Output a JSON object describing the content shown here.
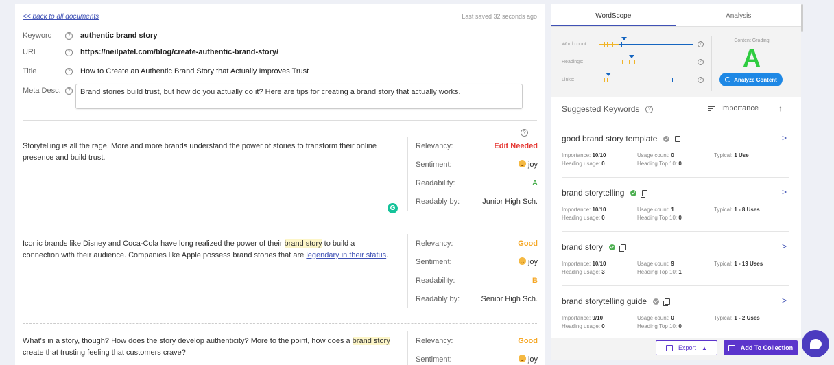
{
  "nav": {
    "back_label": "<< back to all documents",
    "last_saved": "Last saved 32 seconds ago"
  },
  "meta": {
    "keyword": {
      "label": "Keyword",
      "value": "authentic brand story"
    },
    "url": {
      "label": "URL",
      "value": "https://neilpatel.com/blog/create-authentic-brand-story/"
    },
    "title": {
      "label": "Title",
      "value": "How to Create an Authentic Brand Story that Actually Improves Trust"
    },
    "meta_desc": {
      "label": "Meta Desc.",
      "value": "Brand stories build trust, but how do you actually do it? Here are tips for creating a brand story that actually works."
    }
  },
  "metric_labels": {
    "relevancy": "Relevancy:",
    "sentiment": "Sentiment:",
    "readability": "Readability:",
    "readably_by": "Readably by:"
  },
  "paragraphs": [
    {
      "text": "Storytelling is all the rage. More and more brands understand the power of stories to transform their online presence and build trust.",
      "relevancy": "Edit Needed",
      "sentiment": "joy",
      "readability": "A",
      "readably_by": "Junior High Sch."
    },
    {
      "text_before": "Iconic brands like Disney and Coca-Cola have long realized the power of their ",
      "highlight": "brand story",
      "text_mid": " to build a connection with their audience. Companies like Apple possess brand stories that are ",
      "link": "legendary in their status",
      "text_after": ".",
      "relevancy": "Good",
      "sentiment": "joy",
      "readability": "B",
      "readably_by": "Senior High Sch."
    },
    {
      "text_before": "What's in a story, though? How does the story develop authenticity? More to the point, how does a ",
      "highlight": "brand story",
      "text_after": " create that trusting feeling that customers crave?",
      "relevancy": "Good",
      "sentiment": "joy"
    }
  ],
  "right_panel": {
    "tabs": [
      "WordScope",
      "Analysis"
    ],
    "gauges": [
      {
        "label": "Word count:"
      },
      {
        "label": "Headings:"
      },
      {
        "label": "Links:"
      }
    ],
    "grading": {
      "title": "Content Grading",
      "grade": "A",
      "analyze_label": "Analyze Content"
    },
    "suggested": {
      "title": "Suggested Keywords",
      "sort_label": "Importance",
      "sort_arrow": "↑"
    },
    "stat_labels": {
      "importance": "Importance:",
      "usage": "Usage count:",
      "typical": "Typical:",
      "heading_usage": "Heading usage:",
      "heading_top": "Heading Top 10:"
    },
    "keywords": [
      {
        "name": "good brand story template",
        "status": "gray",
        "importance": "10/10",
        "usage": "0",
        "typical": "1 Use",
        "heading_usage": "0",
        "heading_top": "0"
      },
      {
        "name": "brand storytelling",
        "status": "green",
        "importance": "10/10",
        "usage": "1",
        "typical": "1 - 8 Uses",
        "heading_usage": "0",
        "heading_top": "0"
      },
      {
        "name": "brand story",
        "status": "green",
        "importance": "10/10",
        "usage": "9",
        "typical": "1 - 19 Uses",
        "heading_usage": "3",
        "heading_top": "1"
      },
      {
        "name": "brand storytelling guide",
        "status": "gray",
        "importance": "9/10",
        "usage": "0",
        "typical": "1 - 2 Uses",
        "heading_usage": "0",
        "heading_top": "0"
      }
    ],
    "export_label": "Export",
    "collection_label": "Add To Collection"
  }
}
